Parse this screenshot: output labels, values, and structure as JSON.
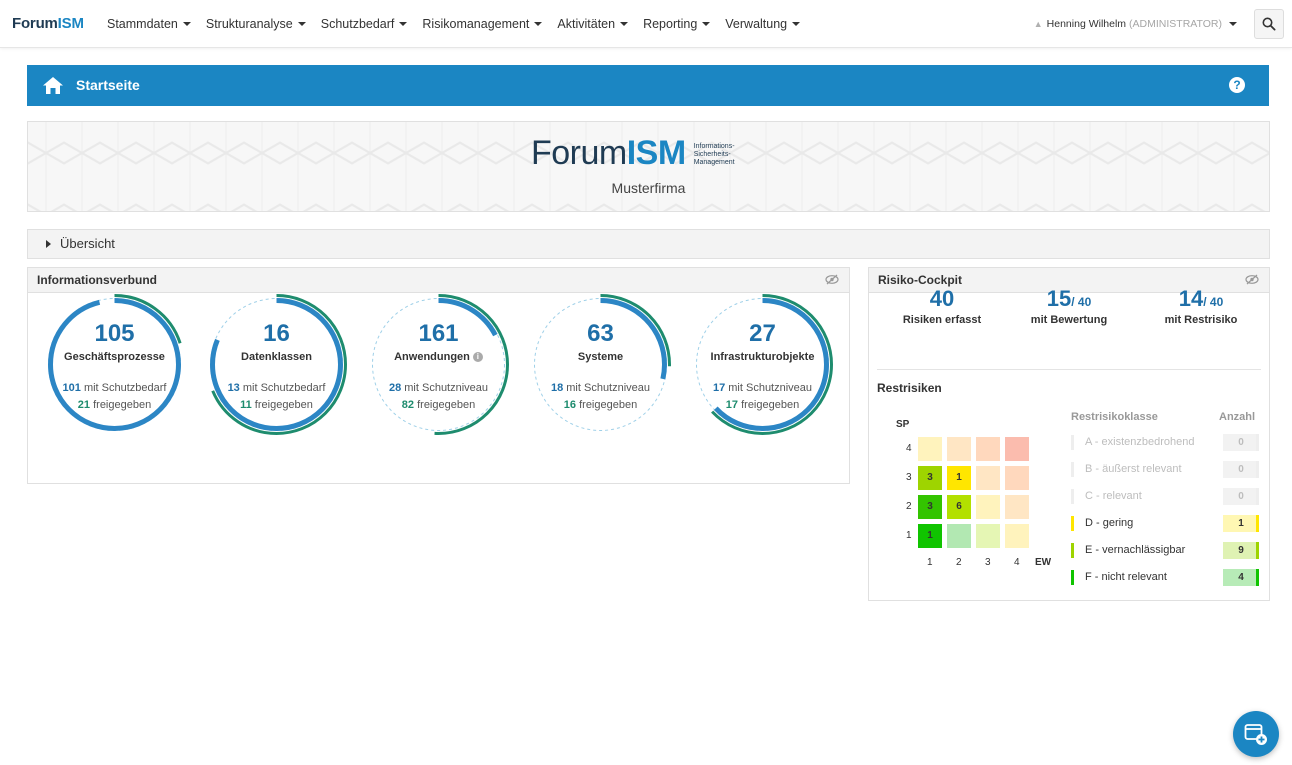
{
  "app": {
    "brand_prefix": "Forum",
    "brand_suffix": "ISM"
  },
  "nav": {
    "menu": [
      "Stammdaten",
      "Strukturanalyse",
      "Schutzbedarf",
      "Risikomanagement",
      "Aktivitäten",
      "Reporting",
      "Verwaltung"
    ],
    "user_name": "Henning Wilhelm",
    "user_role": "(ADMINISTRATOR)",
    "search_icon": "search-icon"
  },
  "header": {
    "title": "Startseite",
    "help": "?"
  },
  "banner": {
    "logo_prefix": "Forum",
    "logo_suffix": "ISM",
    "logo_sub_1": "Informations-",
    "logo_sub_2": "Sicherheits-",
    "logo_sub_3": "Management",
    "company": "Musterfirma"
  },
  "overview": {
    "label": "Übersicht"
  },
  "informationsverbund": {
    "title": "Informationsverbund",
    "items": [
      {
        "count": "105",
        "label": "Geschäftsprozesse",
        "n1": "101",
        "t1": "mit Schutzbedarf",
        "n2": "21",
        "t2": "freigegeben",
        "ratio_blue": 0.962,
        "ratio_green": 0.2
      },
      {
        "count": "16",
        "label": "Datenklassen",
        "n1": "13",
        "t1": "mit Schutzbedarf",
        "n2": "11",
        "t2": "freigegeben",
        "ratio_blue": 0.8125,
        "ratio_green": 0.6875
      },
      {
        "count": "161",
        "label": "Anwendungen",
        "n1": "28",
        "t1": "mit Schutzniveau",
        "n2": "82",
        "t2": "freigegeben",
        "ratio_blue": 0.174,
        "ratio_green": 0.509
      },
      {
        "count": "63",
        "label": "Systeme",
        "n1": "18",
        "t1": "mit Schutzniveau",
        "n2": "16",
        "t2": "freigegeben",
        "ratio_blue": 0.286,
        "ratio_green": 0.254
      },
      {
        "count": "27",
        "label": "Infrastrukturobjekte",
        "n1": "17",
        "t1": "mit Schutzniveau",
        "n2": "17",
        "t2": "freigegeben",
        "ratio_blue": 0.63,
        "ratio_green": 0.63
      }
    ]
  },
  "cockpit": {
    "title": "Risiko-Cockpit",
    "stats": [
      {
        "value": "40",
        "of": "",
        "label": "Risiken erfasst"
      },
      {
        "value": "15",
        "of": "/ 40",
        "label": "mit Bewertung"
      },
      {
        "value": "14",
        "of": "/ 40",
        "label": "mit Restrisiko"
      }
    ],
    "restrisiken_title": "Restrisiken",
    "matrix": {
      "y_label": "SP",
      "x_label": "EW",
      "y_ticks": [
        "4",
        "3",
        "2",
        "1"
      ],
      "x_ticks": [
        "1",
        "2",
        "3",
        "4"
      ],
      "cells": [
        {
          "row": 4,
          "col": 1,
          "value": "",
          "color": "#fff3bd"
        },
        {
          "row": 4,
          "col": 2,
          "value": "",
          "color": "#ffe6c4"
        },
        {
          "row": 4,
          "col": 3,
          "value": "",
          "color": "#ffd8bd"
        },
        {
          "row": 4,
          "col": 4,
          "value": "",
          "color": "#fbbcae"
        },
        {
          "row": 3,
          "col": 1,
          "value": "3",
          "color": "#9ed400"
        },
        {
          "row": 3,
          "col": 2,
          "value": "1",
          "color": "#ffe600"
        },
        {
          "row": 3,
          "col": 3,
          "value": "",
          "color": "#ffe6c4"
        },
        {
          "row": 3,
          "col": 4,
          "value": "",
          "color": "#ffd8bd"
        },
        {
          "row": 2,
          "col": 1,
          "value": "3",
          "color": "#33c400"
        },
        {
          "row": 2,
          "col": 2,
          "value": "6",
          "color": "#b3e000"
        },
        {
          "row": 2,
          "col": 3,
          "value": "",
          "color": "#fff3bd"
        },
        {
          "row": 2,
          "col": 4,
          "value": "",
          "color": "#ffe6c4"
        },
        {
          "row": 1,
          "col": 1,
          "value": "1",
          "color": "#10c400"
        },
        {
          "row": 1,
          "col": 2,
          "value": "",
          "color": "#b2e8b2"
        },
        {
          "row": 1,
          "col": 3,
          "value": "",
          "color": "#e5f6b4"
        },
        {
          "row": 1,
          "col": 4,
          "value": "",
          "color": "#fff3bd"
        }
      ]
    },
    "legend": {
      "head_class": "Restrisikoklasse",
      "head_count": "Anzahl",
      "rows": [
        {
          "label": "A - existenzbedrohend",
          "count": "0",
          "color": "#eeeeee",
          "muted": true
        },
        {
          "label": "B - äußerst relevant",
          "count": "0",
          "color": "#eeeeee",
          "muted": true
        },
        {
          "label": "C - relevant",
          "count": "0",
          "color": "#eeeeee",
          "muted": true
        },
        {
          "label": "D - gering",
          "count": "1",
          "color": "#ffe600",
          "bg": "#fff7b3",
          "muted": false
        },
        {
          "label": "E - vernachlässigbar",
          "count": "9",
          "color": "#9ed400",
          "bg": "#dff2b3",
          "muted": false
        },
        {
          "label": "F - nicht relevant",
          "count": "4",
          "color": "#10c400",
          "bg": "#b7ebb7",
          "muted": false
        }
      ]
    }
  }
}
